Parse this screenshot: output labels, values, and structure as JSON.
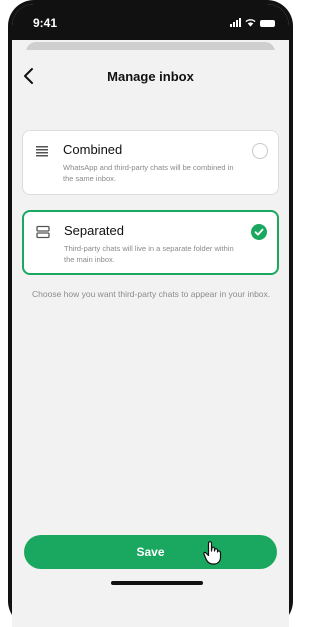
{
  "status_bar": {
    "time": "9:41"
  },
  "header": {
    "title": "Manage inbox"
  },
  "options": [
    {
      "title": "Combined",
      "description": "WhatsApp and third-party chats will be combined in the same inbox.",
      "selected": false
    },
    {
      "title": "Separated",
      "description": "Third-party chats will live in a separate folder within the main inbox.",
      "selected": true
    }
  ],
  "hint": "Choose how you want third-party chats to appear in your inbox.",
  "save": {
    "label": "Save"
  },
  "colors": {
    "accent": "#1aa760"
  }
}
